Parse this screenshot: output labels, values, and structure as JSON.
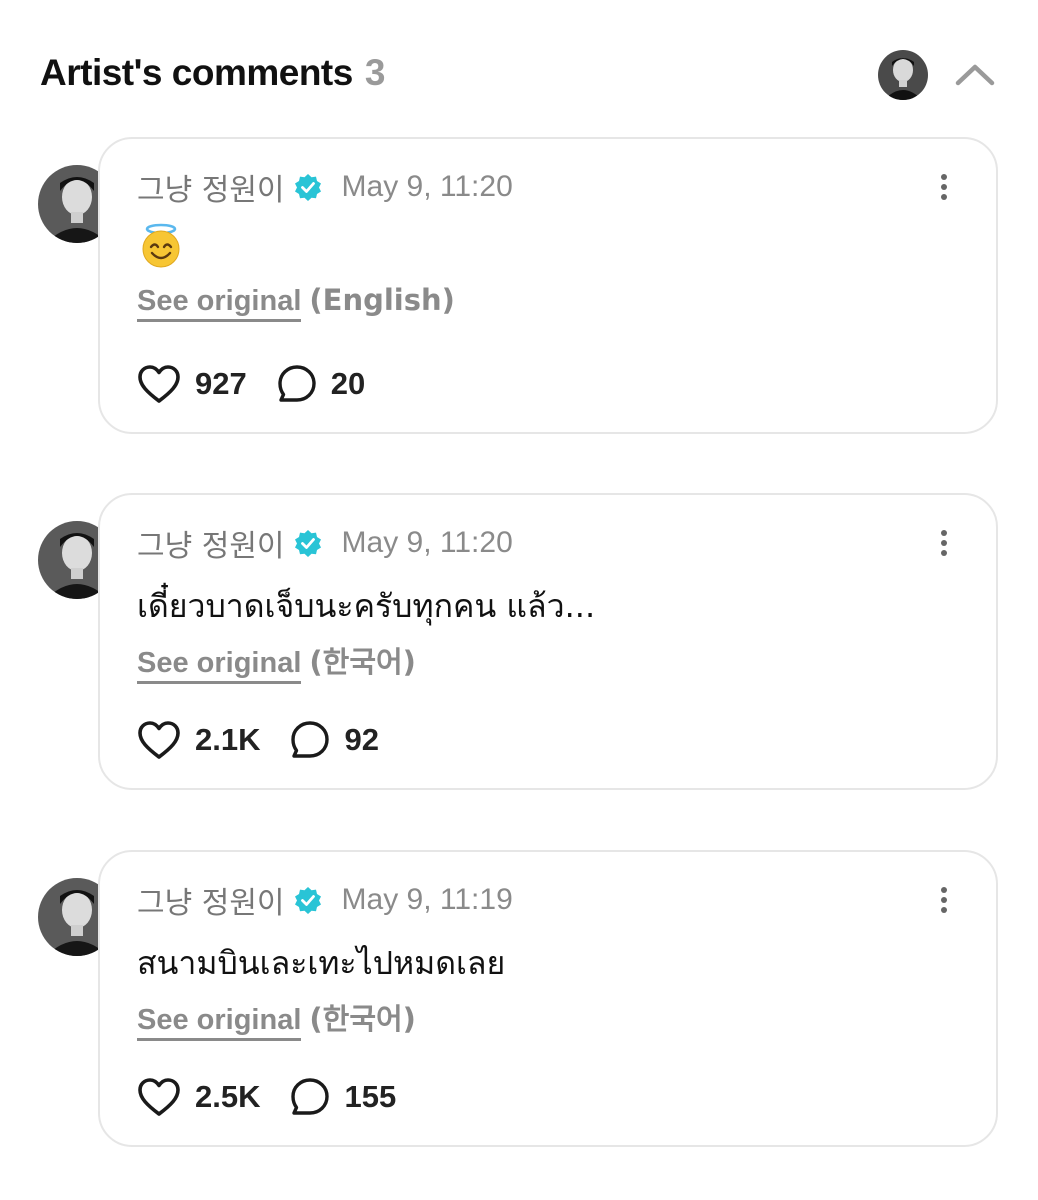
{
  "header": {
    "title": "Artist's comments",
    "count": "3"
  },
  "comments": [
    {
      "author": "그냥 정원이",
      "time": "May 9, 11:20",
      "body_emoji": "smiling-face-with-halo",
      "see_original_label": "See original",
      "language": "(English)",
      "likes": "927",
      "replies": "20"
    },
    {
      "author": "그냥 정원이",
      "time": "May 9, 11:20",
      "body": "เดี๋ยวบาดเจ็บนะครับทุกคน แล้ว...",
      "see_original_label": "See original",
      "language": "(한국어)",
      "likes": "2.1K",
      "replies": "92"
    },
    {
      "author": "그냥 정원이",
      "time": "May 9, 11:19",
      "body": "สนามบินเละเทะไปหมดเลย",
      "see_original_label": "See original",
      "language": "(한국어)",
      "likes": "2.5K",
      "replies": "155"
    }
  ],
  "colors": {
    "verified": "#29c4d6",
    "muted_text": "#8a8a8a",
    "card_border": "#e6e6e6"
  },
  "icons": [
    "avatar",
    "verified-badge-icon",
    "more-options-icon",
    "heart-icon",
    "comment-icon",
    "chevron-up-icon"
  ]
}
